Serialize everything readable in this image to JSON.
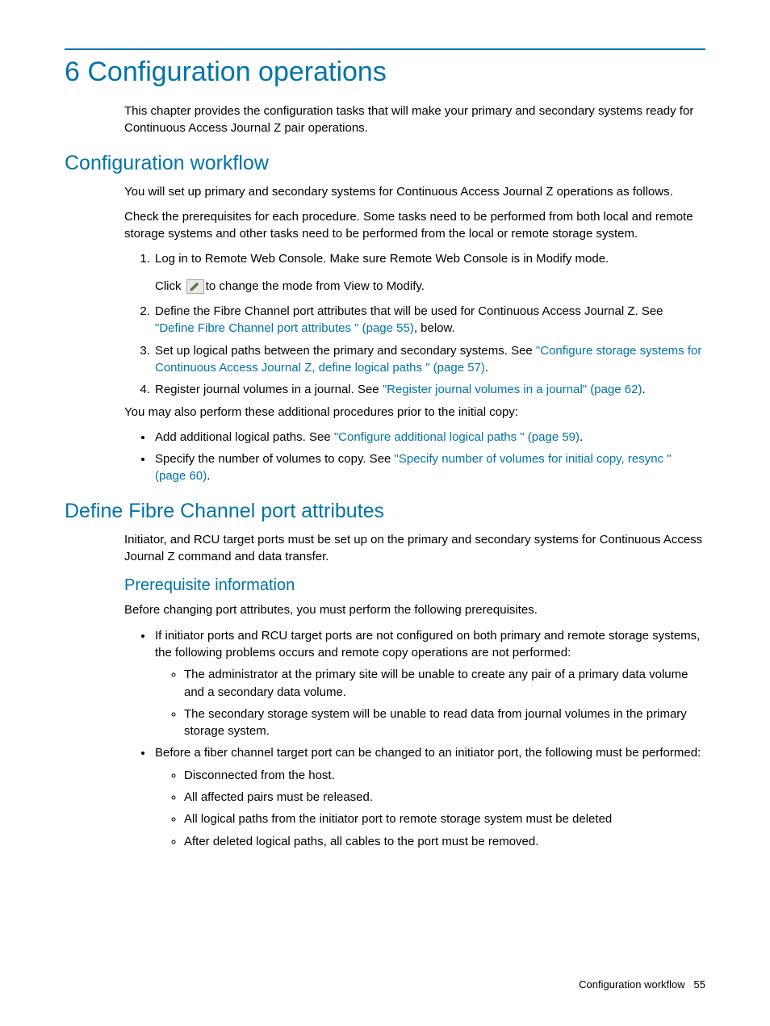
{
  "chapter": {
    "number": "6",
    "title": "Configuration operations",
    "intro": "This chapter provides the configuration tasks that will make your primary and secondary systems ready for Continuous Access Journal Z pair operations."
  },
  "section1": {
    "title": "Configuration workflow",
    "p1": "You will set up primary and secondary systems for Continuous Access Journal Z operations as follows.",
    "p2": "Check the prerequisites for each procedure. Some tasks need to be performed from both local and remote storage systems and other tasks need to be performed from the local or remote storage system.",
    "step1": "Log in to Remote Web Console. Make sure Remote Web Console is in Modify mode.",
    "step1b_pre": "Click ",
    "step1b_post": "to change the mode from View to Modify.",
    "step2_pre": "Define the Fibre Channel port attributes that will be used for Continuous Access Journal Z. See ",
    "step2_link": "\"Define Fibre Channel port attributes \" (page 55)",
    "step2_post": ", below.",
    "step3_pre": "Set up logical paths between the primary and secondary systems. See ",
    "step3_link": "\"Configure storage systems for Continuous Access Journal Z, define logical paths \" (page 57)",
    "step3_post": ".",
    "step4_pre": "Register journal volumes in a journal. See ",
    "step4_link": "\"Register journal volumes in a journal\" (page 62)",
    "step4_post": ".",
    "p3": "You may also perform these additional procedures prior to the initial copy:",
    "bullet1_pre": "Add additional logical paths. See ",
    "bullet1_link": "\"Configure additional logical paths \" (page 59)",
    "bullet1_post": ".",
    "bullet2_pre": "Specify the number of volumes to copy. See ",
    "bullet2_link": "\"Specify number of volumes for initial copy, resync \" (page 60)",
    "bullet2_post": "."
  },
  "section2": {
    "title": "Define Fibre Channel port attributes",
    "p1": "Initiator, and RCU target ports must be set up on the primary and secondary systems for Continuous Access Journal Z command and data transfer.",
    "sub1": {
      "title": "Prerequisite information",
      "p1": "Before changing port attributes, you must perform the following prerequisites.",
      "b1": "If initiator ports and RCU target ports are not configured on both primary and remote storage systems, the following problems occurs and remote copy operations are not performed:",
      "b1s1": "The administrator at the primary site will be unable to create any pair of a primary data volume and a secondary data volume.",
      "b1s2": "The secondary storage system will be unable to read data from journal volumes in the primary storage system.",
      "b2": "Before a fiber channel target port can be changed to an initiator port, the following must be performed:",
      "b2s1": "Disconnected from the host.",
      "b2s2": "All affected pairs must be released.",
      "b2s3": "All logical paths from the initiator port to remote storage system must be deleted",
      "b2s4": "After deleted logical paths, all cables to the port must be removed."
    }
  },
  "footer": {
    "text": "Configuration workflow",
    "page": "55"
  }
}
